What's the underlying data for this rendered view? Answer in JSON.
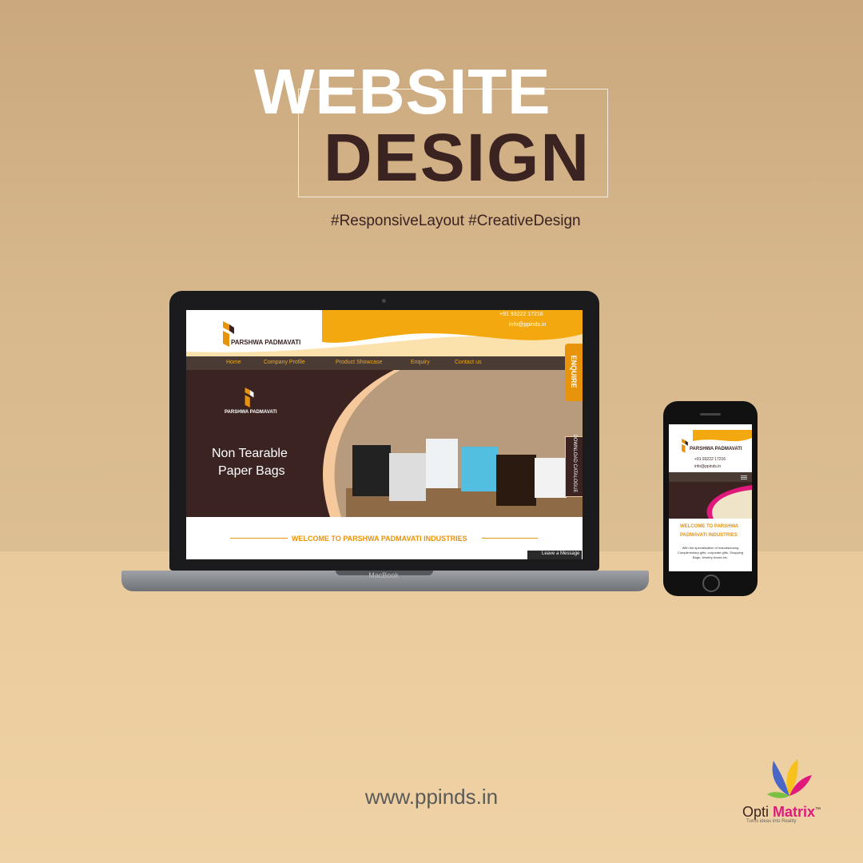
{
  "headline": {
    "line1": "WEBSITE",
    "line2": "DESIGN"
  },
  "tags": "#ResponsiveLayout #CreativeDesign",
  "laptop": {
    "brand": "MacBook",
    "site": {
      "phone": "+91 93222 17216",
      "email": "info@ppinds.in",
      "logo_text": "PARSHWA PADMAVATI",
      "nav": [
        "Home",
        "Company Profile",
        "Product Showcase",
        "Enquiry",
        "Contact us"
      ],
      "enquire": "ENQUIRE",
      "hero_logo": "PARSHWA PADMAVATI",
      "hero_line1": "Non Tearable",
      "hero_line2": "Paper Bags",
      "download_tab": "DOWNLOAD CATALOGUE",
      "welcome": "WELCOME TO PARSHWA PADMAVATI INDUSTRIES",
      "leave_message": "Leave a Message"
    }
  },
  "phone": {
    "logo_text": "PARSHWA PADMAVATI",
    "phone": "+91 93222 17216",
    "email": "info@ppinds.in",
    "welcome_line1": "WELCOME TO PARSHWA",
    "welcome_line2": "PADMAVATI INDUSTRIES",
    "description": "With the specialization of manufacturing Complimentary gifts, corporate gifts, Shopping Bags, Jewelry boxes etc."
  },
  "url": "www.ppinds.in",
  "footer_brand": {
    "name_part1": "Opti ",
    "name_part2": "Matrix",
    "trademark": "™",
    "tagline": "Turns ideas into Reality"
  },
  "colors": {
    "brown": "#3a2321",
    "orange": "#e8930c",
    "pink": "#e0197d",
    "background": "#d8b98d"
  }
}
